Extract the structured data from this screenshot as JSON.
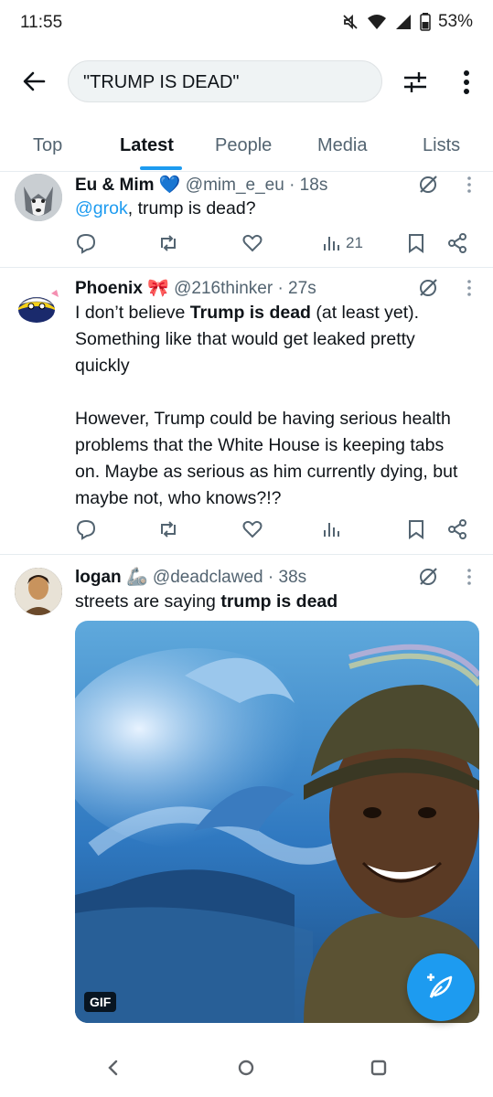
{
  "status_bar": {
    "time": "11:55",
    "battery": "53%",
    "icons": [
      "mute-icon",
      "wifi-icon",
      "signal-icon",
      "battery-icon"
    ]
  },
  "header": {
    "search_query": "\"TRUMP IS DEAD\"",
    "icons": [
      "back-arrow-icon",
      "filter-sliders-icon",
      "more-vertical-icon"
    ]
  },
  "tabs": [
    "Top",
    "Latest",
    "People",
    "Media",
    "Lists"
  ],
  "active_tab": "Latest",
  "tweets": [
    {
      "name": "Eu & Mim",
      "name_emoji": "💙",
      "handle": "@mim_e_eu",
      "time": "· 18s",
      "body_mention": "@grok",
      "body_rest": ", trump is dead?",
      "views": "21"
    },
    {
      "name": "Phoenix",
      "name_emoji": "🎀",
      "handle": "@216thinker",
      "time": "· 27s",
      "p1_pre": "I don’t believe ",
      "p1_bold": "Trump is dead",
      "p1_post": " (at least yet). Something like that would get leaked pretty quickly",
      "p2": "However, Trump could be having serious health problems that the White House is keeping tabs on. Maybe as serious as him currently dying, but maybe not, who knows?!?",
      "views": ""
    },
    {
      "name": "logan",
      "name_emoji": "🦾",
      "handle": "@deadclawed",
      "time": "· 38s",
      "body_pre": "streets are saying ",
      "body_bold": "trump is dead",
      "media_badge": "GIF"
    }
  ],
  "colors": {
    "accent": "#1d9bf0",
    "text_primary": "#0f1419",
    "text_secondary": "#536471"
  }
}
